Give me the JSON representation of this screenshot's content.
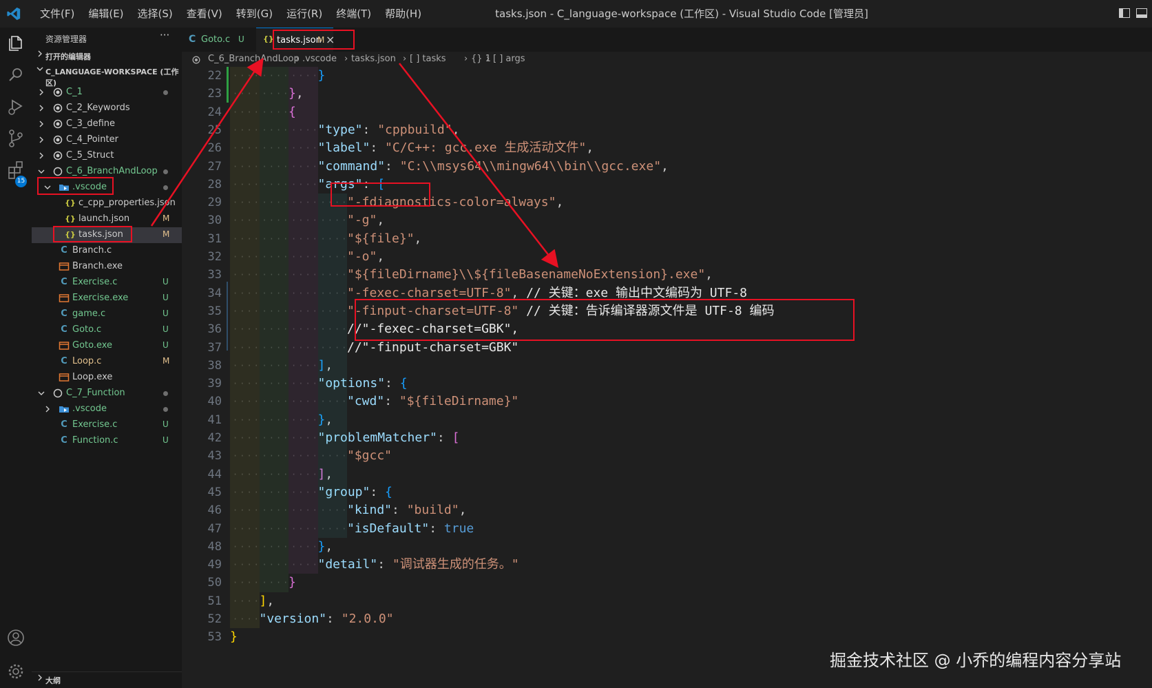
{
  "app": {
    "menu": [
      "文件(F)",
      "编辑(E)",
      "选择(S)",
      "查看(V)",
      "转到(G)",
      "运行(R)",
      "终端(T)",
      "帮助(H)"
    ],
    "window_title": "tasks.json - C_language-workspace (工作区) - Visual Studio Code [管理员]"
  },
  "activity_bar": {
    "icons": [
      "explorer-icon",
      "search-icon",
      "run-debug-icon",
      "source-control-icon",
      "extensions-icon",
      "account-icon",
      "settings-gear-icon"
    ],
    "scm_badge": "15"
  },
  "sidebar": {
    "title": "资源管理器",
    "more": "···",
    "open_editors": "打开的编辑器",
    "workspace": "C_LANGUAGE-WORKSPACE (工作区)",
    "outline": "大纲",
    "tree": [
      {
        "label": "C_1",
        "depth": 0,
        "kind": "root",
        "expanded": false,
        "dot": true
      },
      {
        "label": "C_2_Keywords",
        "depth": 0,
        "kind": "root",
        "expanded": false
      },
      {
        "label": "C_3_define",
        "depth": 0,
        "kind": "root",
        "expanded": false
      },
      {
        "label": "C_4_Pointer",
        "depth": 0,
        "kind": "root",
        "expanded": false
      },
      {
        "label": "C_5_Struct",
        "depth": 0,
        "kind": "root",
        "expanded": false
      },
      {
        "label": "C_6_BranchAndLoop",
        "depth": 0,
        "kind": "root-open",
        "expanded": true,
        "dot": true
      },
      {
        "label": ".vscode",
        "depth": 1,
        "kind": "folder-open",
        "expanded": true,
        "dot": true
      },
      {
        "label": "c_cpp_properties.json",
        "depth": 2,
        "kind": "json"
      },
      {
        "label": "launch.json",
        "depth": 2,
        "kind": "json",
        "status": "M"
      },
      {
        "label": "tasks.json",
        "depth": 2,
        "kind": "json",
        "status": "M",
        "selected": true
      },
      {
        "label": "Branch.c",
        "depth": 1,
        "kind": "c"
      },
      {
        "label": "Branch.exe",
        "depth": 1,
        "kind": "exe"
      },
      {
        "label": "Exercise.c",
        "depth": 1,
        "kind": "c",
        "status": "U"
      },
      {
        "label": "Exercise.exe",
        "depth": 1,
        "kind": "exe",
        "status": "U"
      },
      {
        "label": "game.c",
        "depth": 1,
        "kind": "c",
        "status": "U"
      },
      {
        "label": "Goto.c",
        "depth": 1,
        "kind": "c",
        "status": "U"
      },
      {
        "label": "Goto.exe",
        "depth": 1,
        "kind": "exe",
        "status": "U"
      },
      {
        "label": "Loop.c",
        "depth": 1,
        "kind": "c",
        "status": "M"
      },
      {
        "label": "Loop.exe",
        "depth": 1,
        "kind": "exe"
      },
      {
        "label": "C_7_Function",
        "depth": 0,
        "kind": "root-open",
        "expanded": true,
        "dot": true
      },
      {
        "label": ".vscode",
        "depth": 1,
        "kind": "folder",
        "expanded": false,
        "dot": true
      },
      {
        "label": "Exercise.c",
        "depth": 1,
        "kind": "c",
        "status": "U"
      },
      {
        "label": "Function.c",
        "depth": 1,
        "kind": "c",
        "status": "U"
      }
    ]
  },
  "tabs": [
    {
      "label": "Goto.c",
      "status": "U",
      "icon": "C",
      "active": false
    },
    {
      "label": "tasks.json",
      "status": "M",
      "icon": "{}",
      "active": true,
      "close": "×"
    }
  ],
  "breadcrumb": [
    "C_6_BranchAndLoop",
    ".vscode",
    "tasks.json",
    "[ ] tasks",
    "{} 1",
    "[ ] args"
  ],
  "editor": {
    "lines": [
      {
        "n": "22",
        "indent": 3,
        "tokens": [
          [
            "}",
            "b2"
          ]
        ]
      },
      {
        "n": "23",
        "indent": 2,
        "tokens": [
          [
            "}",
            "b1"
          ],
          [
            ",",
            "p"
          ]
        ]
      },
      {
        "n": "24",
        "indent": 2,
        "tokens": [
          [
            "{",
            "b1"
          ]
        ]
      },
      {
        "n": "25",
        "indent": 3,
        "tokens": [
          [
            "\"type\"",
            "k"
          ],
          [
            ": ",
            "p"
          ],
          [
            "\"cppbuild\"",
            "s"
          ],
          [
            ",",
            "p"
          ]
        ]
      },
      {
        "n": "26",
        "indent": 3,
        "tokens": [
          [
            "\"label\"",
            "k"
          ],
          [
            ": ",
            "p"
          ],
          [
            "\"C/C++: gcc.exe 生成活动文件\"",
            "s"
          ],
          [
            ",",
            "p"
          ]
        ]
      },
      {
        "n": "27",
        "indent": 3,
        "tokens": [
          [
            "\"command\"",
            "k"
          ],
          [
            ": ",
            "p"
          ],
          [
            "\"C:\\\\msys64\\\\mingw64\\\\bin\\\\gcc.exe\"",
            "s"
          ],
          [
            ",",
            "p"
          ]
        ]
      },
      {
        "n": "28",
        "indent": 3,
        "tokens": [
          [
            "\"args\"",
            "k"
          ],
          [
            ": ",
            "p"
          ],
          [
            "[",
            "b2"
          ]
        ]
      },
      {
        "n": "29",
        "indent": 4,
        "tokens": [
          [
            "\"-fdiagnostics-color=always\"",
            "s"
          ],
          [
            ",",
            "p"
          ]
        ]
      },
      {
        "n": "30",
        "indent": 4,
        "tokens": [
          [
            "\"-g\"",
            "s"
          ],
          [
            ",",
            "p"
          ]
        ]
      },
      {
        "n": "31",
        "indent": 4,
        "tokens": [
          [
            "\"${file}\"",
            "s"
          ],
          [
            ",",
            "p"
          ]
        ]
      },
      {
        "n": "32",
        "indent": 4,
        "tokens": [
          [
            "\"-o\"",
            "s"
          ],
          [
            ",",
            "p"
          ]
        ]
      },
      {
        "n": "33",
        "indent": 4,
        "tokens": [
          [
            "\"${fileDirname}\\\\${fileBasenameNoExtension}.exe\"",
            "s"
          ],
          [
            ",",
            "p"
          ]
        ]
      },
      {
        "n": "34",
        "indent": 4,
        "tokens": [
          [
            "\"-fexec-charset=UTF-8\"",
            "s"
          ],
          [
            ", ",
            "p"
          ],
          [
            "// 关键：exe 输出中文编码为 UTF-8",
            "cm"
          ]
        ]
      },
      {
        "n": "35",
        "indent": 4,
        "tokens": [
          [
            "\"-finput-charset=UTF-8\"",
            "s"
          ],
          [
            " ",
            "p"
          ],
          [
            "// 关键：告诉编译器源文件是 UTF-8 编码",
            "cm"
          ]
        ]
      },
      {
        "n": "36",
        "indent": 4,
        "tokens": [
          [
            "//\"-fexec-charset=GBK\",",
            "cm"
          ]
        ]
      },
      {
        "n": "37",
        "indent": 4,
        "tokens": [
          [
            "//\"-finput-charset=GBK\"",
            "cm"
          ]
        ]
      },
      {
        "n": "38",
        "indent": 3,
        "tokens": [
          [
            "]",
            "b2"
          ],
          [
            ",",
            "p"
          ]
        ]
      },
      {
        "n": "39",
        "indent": 3,
        "tokens": [
          [
            "\"options\"",
            "k"
          ],
          [
            ": ",
            "p"
          ],
          [
            "{",
            "b2"
          ]
        ]
      },
      {
        "n": "40",
        "indent": 4,
        "tokens": [
          [
            "\"cwd\"",
            "k"
          ],
          [
            ": ",
            "p"
          ],
          [
            "\"${fileDirname}\"",
            "s"
          ]
        ]
      },
      {
        "n": "41",
        "indent": 3,
        "tokens": [
          [
            "}",
            "b2"
          ],
          [
            ",",
            "p"
          ]
        ]
      },
      {
        "n": "42",
        "indent": 3,
        "tokens": [
          [
            "\"problemMatcher\"",
            "k"
          ],
          [
            ": ",
            "p"
          ],
          [
            "[",
            "b1"
          ]
        ]
      },
      {
        "n": "43",
        "indent": 4,
        "tokens": [
          [
            "\"$gcc\"",
            "s"
          ]
        ]
      },
      {
        "n": "44",
        "indent": 3,
        "tokens": [
          [
            "]",
            "b1"
          ],
          [
            ",",
            "p"
          ]
        ]
      },
      {
        "n": "45",
        "indent": 3,
        "tokens": [
          [
            "\"group\"",
            "k"
          ],
          [
            ": ",
            "p"
          ],
          [
            "{",
            "b2"
          ]
        ]
      },
      {
        "n": "46",
        "indent": 4,
        "tokens": [
          [
            "\"kind\"",
            "k"
          ],
          [
            ": ",
            "p"
          ],
          [
            "\"build\"",
            "s"
          ],
          [
            ",",
            "p"
          ]
        ]
      },
      {
        "n": "47",
        "indent": 4,
        "tokens": [
          [
            "\"isDefault\"",
            "k"
          ],
          [
            ": ",
            "p"
          ],
          [
            "true",
            "kw"
          ]
        ]
      },
      {
        "n": "48",
        "indent": 3,
        "tokens": [
          [
            "}",
            "b2"
          ],
          [
            ",",
            "p"
          ]
        ]
      },
      {
        "n": "49",
        "indent": 3,
        "tokens": [
          [
            "\"detail\"",
            "k"
          ],
          [
            ": ",
            "p"
          ],
          [
            "\"调试器生成的任务。\"",
            "s"
          ]
        ]
      },
      {
        "n": "50",
        "indent": 2,
        "tokens": [
          [
            "}",
            "b1"
          ]
        ]
      },
      {
        "n": "51",
        "indent": 1,
        "tokens": [
          [
            "]",
            "b3"
          ],
          [
            ",",
            "p"
          ]
        ]
      },
      {
        "n": "52",
        "indent": 1,
        "tokens": [
          [
            "\"version\"",
            "k"
          ],
          [
            ": ",
            "p"
          ],
          [
            "\"2.0.0\"",
            "s"
          ]
        ]
      },
      {
        "n": "53",
        "indent": 0,
        "tokens": [
          [
            "}",
            "b3"
          ]
        ]
      }
    ]
  },
  "watermark": "掘金技术社区 @ 小乔的编程内容分享站",
  "annotation_color": "#e81123"
}
